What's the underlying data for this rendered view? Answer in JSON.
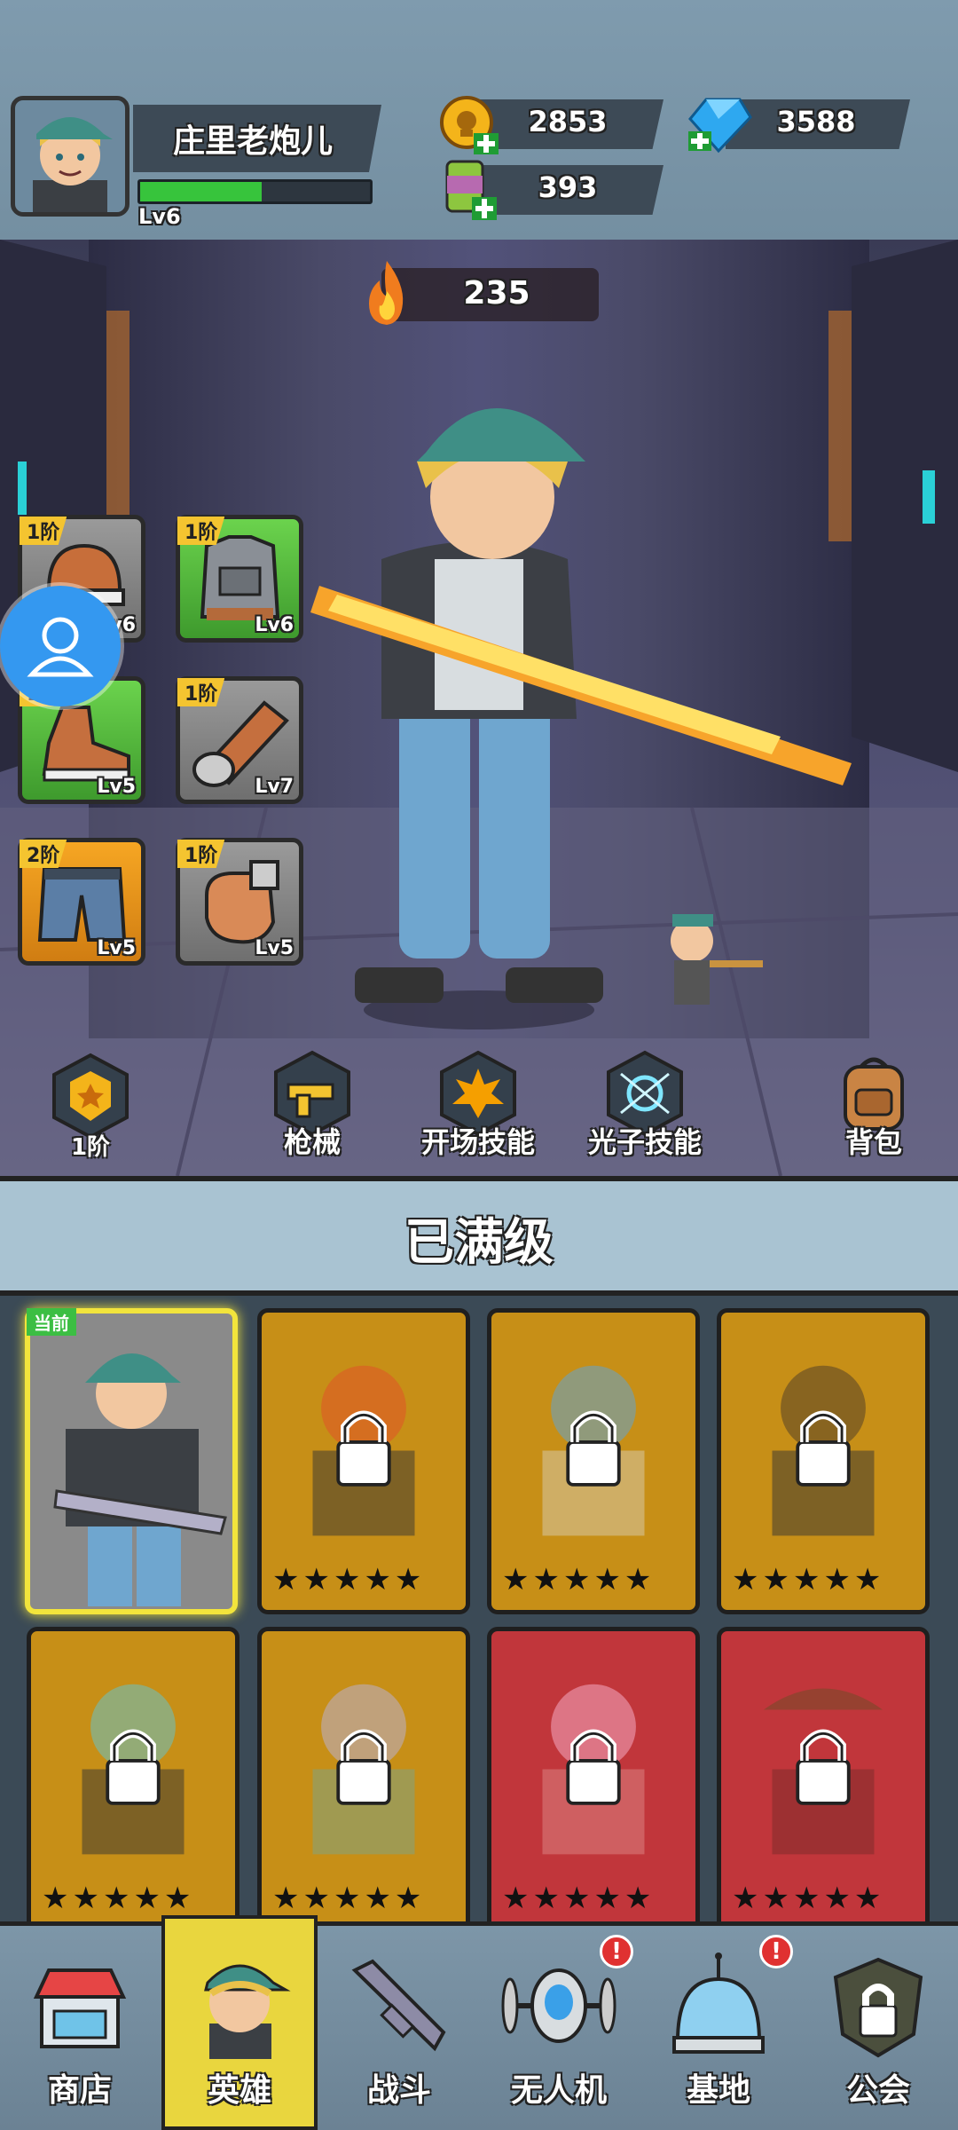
{
  "player": {
    "name": "庄里老炮儿",
    "level": "Lv6",
    "xp_fraction": 0.53
  },
  "resources": {
    "coins": "2853",
    "gems": "3588",
    "cans": "393"
  },
  "power": "235",
  "equipment": [
    {
      "tier": "1阶",
      "level": "Lv6",
      "icon": "helmet-icon",
      "color": "gray"
    },
    {
      "tier": "1阶",
      "level": "Lv6",
      "icon": "vest-icon",
      "color": "green"
    },
    {
      "tier": "1阶",
      "level": "Lv5",
      "icon": "boot-icon",
      "color": "green"
    },
    {
      "tier": "1阶",
      "level": "Lv7",
      "icon": "arm-guard-icon",
      "color": "gray"
    },
    {
      "tier": "2阶",
      "level": "Lv5",
      "icon": "pants-icon",
      "color": "orange"
    },
    {
      "tier": "1阶",
      "level": "Lv5",
      "icon": "glove-icon",
      "color": "gray"
    }
  ],
  "skills": {
    "rank": "1阶",
    "weapon": "枪械",
    "opening": "开场技能",
    "photon": "光子技能",
    "bag": "背包"
  },
  "banner": "已满级",
  "current_tag": "当前",
  "heroes": [
    {
      "locked": false,
      "color": "current"
    },
    {
      "locked": true,
      "color": "gold",
      "stars": "★★★★★"
    },
    {
      "locked": true,
      "color": "gold",
      "stars": "★★★★★"
    },
    {
      "locked": true,
      "color": "gold",
      "stars": "★★★★★"
    },
    {
      "locked": true,
      "color": "gold",
      "stars": "★★★★★"
    },
    {
      "locked": true,
      "color": "gold",
      "stars": "★★★★★"
    },
    {
      "locked": true,
      "color": "red",
      "stars": "★★★★★"
    },
    {
      "locked": true,
      "color": "red",
      "stars": "★★★★★"
    }
  ],
  "nav": {
    "shop": "商店",
    "heroes": "英雄",
    "battle": "战斗",
    "drone": "无人机",
    "base": "基地",
    "guild": "公会",
    "alert": "!"
  },
  "colors": {
    "xp_green": "#37c43c",
    "active_tab": "#e9d63e",
    "alert_red": "#e03131",
    "card_gold": "#c78f17",
    "card_red": "#c1363b"
  }
}
